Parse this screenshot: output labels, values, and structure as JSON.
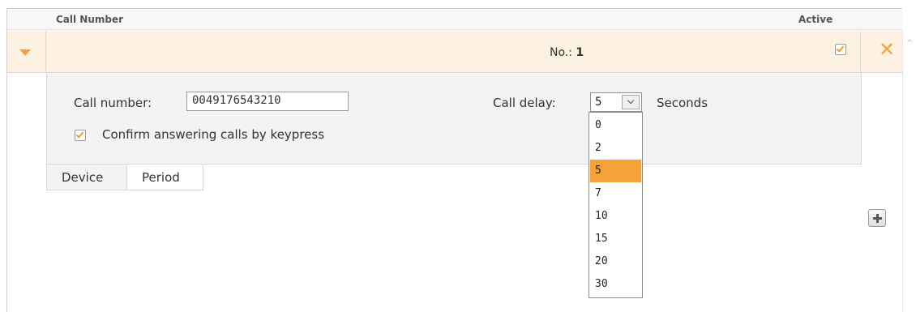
{
  "table": {
    "col_call_number": "Call Number",
    "col_active": "Active"
  },
  "row": {
    "title_prefix": "No.:",
    "title_number": "1",
    "active_checked": true
  },
  "detail": {
    "call_number_label": "Call number:",
    "call_number_value": "0049176543210",
    "call_delay_label": "Call delay:",
    "call_delay_value": "5",
    "seconds_label": "Seconds",
    "confirm_label": "Confirm answering calls by keypress",
    "confirm_checked": true
  },
  "dropdown": {
    "options": [
      "0",
      "2",
      "5",
      "7",
      "10",
      "15",
      "20",
      "30"
    ],
    "selected": "5"
  },
  "tabs": [
    {
      "label": "Device"
    },
    {
      "label": "Period"
    }
  ],
  "icons": {
    "delete": "close-icon",
    "add": "plus-icon",
    "expand": "triangle-down-icon"
  },
  "colors": {
    "accent": "#f7a13a",
    "row_bg": "#fdf1e1",
    "panel_bg": "#f3f3f3"
  }
}
